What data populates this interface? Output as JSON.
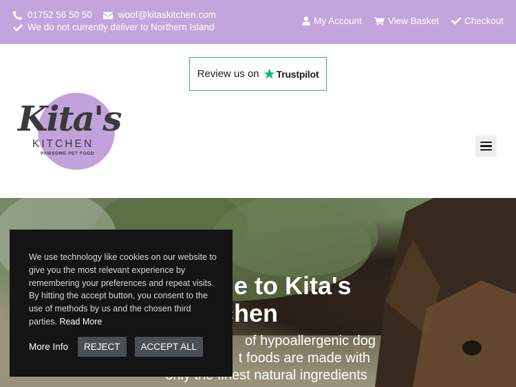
{
  "topbar": {
    "phone": "01752 56 50 50",
    "email": "woof@kitaskitchen.com",
    "notice": "We do not currently deliver to Northern Island",
    "links": [
      "My Account",
      "View Basket",
      "Checkout"
    ],
    "background": "#c4a4dc"
  },
  "trustpilot": {
    "prefix": "Review us on",
    "brand": "Trustpilot",
    "accent": "#21b784"
  },
  "logo": {
    "main": "Kita's",
    "sub": "KITCHEN",
    "tagline": "PAWSOME PET FOOD"
  },
  "menu": {
    "icon": "hamburger-menu-icon"
  },
  "hero": {
    "title": "Welcome to Kita's Kitchen",
    "title_visible_line1": "me to Kita's",
    "title_visible_line2": "tchen",
    "subtitle_line1": "of hypoallergenic dog",
    "subtitle_line2": "t foods are made with",
    "subtitle_line3": "only the finest natural ingredients"
  },
  "cookie": {
    "text": "We use technology like cookies on our website to give you the most relevant experience by remembering your preferences and repeat visits. By hitting the accept button, you consent to the use of methods by us and the chosen third parties.",
    "read_more": "Read More",
    "more_info": "More Info",
    "reject": "REJECT",
    "accept_all": "ACCEPT ALL"
  }
}
